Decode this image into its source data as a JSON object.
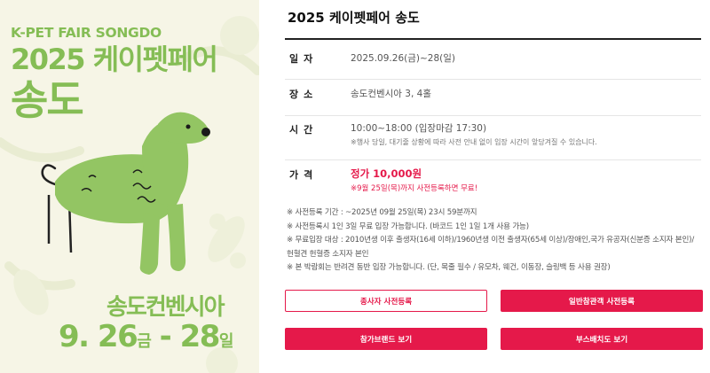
{
  "poster": {
    "subtitle": "K-PET FAIR SONGDO",
    "title_line1": "2025 케이펫페어",
    "title_line2": "송도",
    "venue": "송도컨벤시아",
    "date_day1": "9. 26",
    "date_wd1": "금",
    "date_sep": " - ",
    "date_day2": "28",
    "date_wd2": "일"
  },
  "info": {
    "title": "2025 케이펫페어 송도",
    "date": {
      "label": "일자",
      "value": "2025.09.26(금)~28(일)"
    },
    "place": {
      "label": "장소",
      "value": "송도컨벤시아 3, 4홀"
    },
    "time": {
      "label": "시간",
      "value": "10:00~18:00 (입장마감 17:30)",
      "note": "※행사 당일, 대기줄 상황에 따라 사전 안내 없이 입장 시간이 앞당겨질 수 있습니다."
    },
    "price": {
      "label": "가격",
      "value": "정가 10,000원",
      "note": "※9월 25일(목)까지 사전등록하면 무료!"
    },
    "notes": [
      "※ 사전등록 기간 : ~2025년 09월 25일(목) 23시 59분까지",
      "※ 사전등록시 1인 3일 무료 입장 가능합니다. (바코드 1인 1일 1개 사용 가능)",
      "※ 무료입장 대상 : 2010년생 이후 출생자(16세 이하)/1960년생 이전 출생자(65세 이상)/장애인,국가 유공자(신분증 소지자 본인)/",
      "헌혈견 헌혈증 소지자 본인",
      "※ 본 박람회는 반려견 동반 입장 가능합니다. (단, 목줄 필수 / 유모차, 웨건, 이동장, 슬링백 등 사용 권장)"
    ]
  },
  "buttons": {
    "exhibitor_reg": "종사자 사전등록",
    "visitor_reg": "일반참관객 사전등록",
    "brands": "참가브랜드 보기",
    "booth_map": "부스배치도 보기"
  },
  "colors": {
    "accent": "#e5194a",
    "poster_green": "#85bd55",
    "poster_bg": "#f6f5e6"
  }
}
